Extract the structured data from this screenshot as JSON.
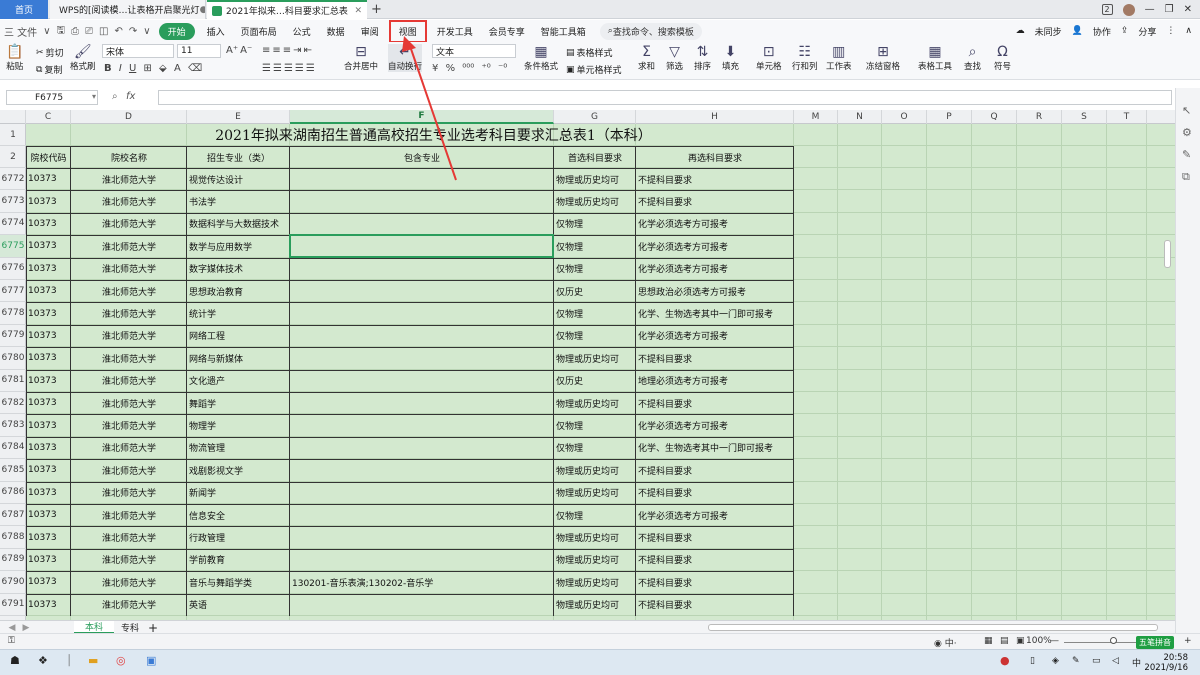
{
  "tabs": {
    "home": "首页",
    "doc1": "WPS的[阅读模…让表格开启聚光灯",
    "doc2": "2021年拟来…科目要求汇总表",
    "new_tab": "+"
  },
  "quick_access": {
    "file": "三 文件",
    "file_arrow": "∨"
  },
  "menu": [
    "开始",
    "插入",
    "页面布局",
    "公式",
    "数据",
    "审阅",
    "视图",
    "开发工具",
    "会员专享",
    "智能工具箱"
  ],
  "highlighted_menu": "视图",
  "search": {
    "label": "查找命令、搜索模板"
  },
  "right_menu": {
    "unsync": "未同步",
    "collab": "协作",
    "share": "分享"
  },
  "ribbon": {
    "paste": "粘贴",
    "cut": "剪切",
    "copy": "复制",
    "format_painter": "格式刷",
    "font_name": "宋体",
    "font_size": "11",
    "merge": "合并居中",
    "wrap": "自动换行",
    "number_format": "文本",
    "table_style": "表格样式",
    "conditional": "条件格式",
    "cell_style": "单元格样式",
    "sum": "求和",
    "filter": "筛选",
    "sort": "排序",
    "fill": "填充",
    "cell": "单元格",
    "rowcol": "行和列",
    "worksheet": "工作表",
    "freeze": "冻结窗格",
    "table_tools": "表格工具",
    "find": "查找",
    "symbol": "符号"
  },
  "formula_bar": {
    "cell_ref": "F6775",
    "fx": "fx",
    "content": ""
  },
  "columns": [
    "C",
    "D",
    "E",
    "F",
    "G",
    "H",
    "M",
    "N",
    "O",
    "P",
    "Q",
    "R",
    "S",
    "T"
  ],
  "active_column": "F",
  "sheet": {
    "title": "2021年拟来湖南招生普通高校招生专业选考科目要求汇总表1（本科）",
    "headers": [
      "院校代码",
      "院校名称",
      "招生专业（类）",
      "包含专业",
      "首选科目要求",
      "再选科目要求"
    ],
    "rows": [
      {
        "n": "6772",
        "code": "10373",
        "school": "淮北师范大学",
        "major": "视觉传达设计",
        "includes": "",
        "first": "物理或历史均可",
        "second": "不提科目要求"
      },
      {
        "n": "6773",
        "code": "10373",
        "school": "淮北师范大学",
        "major": "书法学",
        "includes": "",
        "first": "物理或历史均可",
        "second": "不提科目要求"
      },
      {
        "n": "6774",
        "code": "10373",
        "school": "淮北师范大学",
        "major": "数据科学与大数据技术",
        "includes": "",
        "first": "仅物理",
        "second": "化学必须选考方可报考"
      },
      {
        "n": "6775",
        "code": "10373",
        "school": "淮北师范大学",
        "major": "数学与应用数学",
        "includes": "",
        "first": "仅物理",
        "second": "化学必须选考方可报考"
      },
      {
        "n": "6776",
        "code": "10373",
        "school": "淮北师范大学",
        "major": "数字媒体技术",
        "includes": "",
        "first": "仅物理",
        "second": "化学必须选考方可报考"
      },
      {
        "n": "6777",
        "code": "10373",
        "school": "淮北师范大学",
        "major": "思想政治教育",
        "includes": "",
        "first": "仅历史",
        "second": "思想政治必须选考方可报考"
      },
      {
        "n": "6778",
        "code": "10373",
        "school": "淮北师范大学",
        "major": "统计学",
        "includes": "",
        "first": "仅物理",
        "second": "化学、生物选考其中一门即可报考"
      },
      {
        "n": "6779",
        "code": "10373",
        "school": "淮北师范大学",
        "major": "网络工程",
        "includes": "",
        "first": "仅物理",
        "second": "化学必须选考方可报考"
      },
      {
        "n": "6780",
        "code": "10373",
        "school": "淮北师范大学",
        "major": "网络与新媒体",
        "includes": "",
        "first": "物理或历史均可",
        "second": "不提科目要求"
      },
      {
        "n": "6781",
        "code": "10373",
        "school": "淮北师范大学",
        "major": "文化遗产",
        "includes": "",
        "first": "仅历史",
        "second": "地理必须选考方可报考"
      },
      {
        "n": "6782",
        "code": "10373",
        "school": "淮北师范大学",
        "major": "舞蹈学",
        "includes": "",
        "first": "物理或历史均可",
        "second": "不提科目要求"
      },
      {
        "n": "6783",
        "code": "10373",
        "school": "淮北师范大学",
        "major": "物理学",
        "includes": "",
        "first": "仅物理",
        "second": "化学必须选考方可报考"
      },
      {
        "n": "6784",
        "code": "10373",
        "school": "淮北师范大学",
        "major": "物流管理",
        "includes": "",
        "first": "仅物理",
        "second": "化学、生物选考其中一门即可报考"
      },
      {
        "n": "6785",
        "code": "10373",
        "school": "淮北师范大学",
        "major": "戏剧影视文学",
        "includes": "",
        "first": "物理或历史均可",
        "second": "不提科目要求"
      },
      {
        "n": "6786",
        "code": "10373",
        "school": "淮北师范大学",
        "major": "新闻学",
        "includes": "",
        "first": "物理或历史均可",
        "second": "不提科目要求"
      },
      {
        "n": "6787",
        "code": "10373",
        "school": "淮北师范大学",
        "major": "信息安全",
        "includes": "",
        "first": "仅物理",
        "second": "化学必须选考方可报考"
      },
      {
        "n": "6788",
        "code": "10373",
        "school": "淮北师范大学",
        "major": "行政管理",
        "includes": "",
        "first": "物理或历史均可",
        "second": "不提科目要求"
      },
      {
        "n": "6789",
        "code": "10373",
        "school": "淮北师范大学",
        "major": "学前教育",
        "includes": "",
        "first": "物理或历史均可",
        "second": "不提科目要求"
      },
      {
        "n": "6790",
        "code": "10373",
        "school": "淮北师范大学",
        "major": "音乐与舞蹈学类",
        "includes": "130201-音乐表演;130202-音乐学",
        "first": "物理或历史均可",
        "second": "不提科目要求"
      },
      {
        "n": "6791",
        "code": "10373",
        "school": "淮北师范大学",
        "major": "英语",
        "includes": "",
        "first": "物理或历史均可",
        "second": "不提科目要求"
      }
    ],
    "active_row": "6775"
  },
  "sheet_tabs": [
    "本科",
    "专科"
  ],
  "active_sheet": "本科",
  "status": {
    "zoom": "100%",
    "ime": "五笔拼音"
  },
  "clock": {
    "time": "20:58",
    "date": "2021/9/16"
  },
  "colors": {
    "accent": "#2a9d5c",
    "highlight_box": "#e53935",
    "cell_fill": "#d3e9cf"
  }
}
